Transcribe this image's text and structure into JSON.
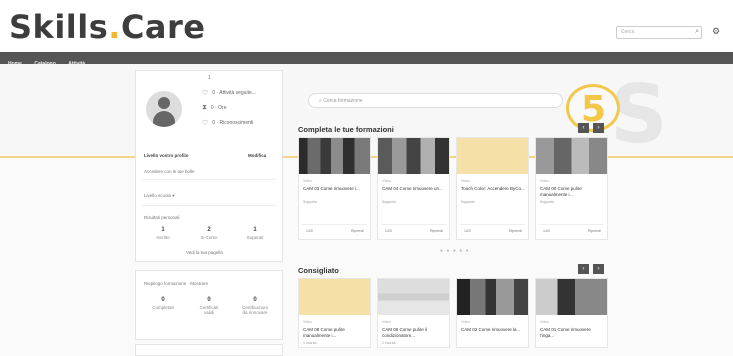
{
  "header": {
    "logo_part1": "Skills",
    "logo_dot": ".",
    "logo_part2": "Care",
    "search_placeholder": "Cerca",
    "search_btn": "⌕",
    "user_icon": "⚙"
  },
  "nav": {
    "items": [
      "Home",
      "Catalogo",
      "Attività"
    ]
  },
  "profile": {
    "name": "1",
    "links": [
      {
        "icon": "heart-icon",
        "glyph": "♡",
        "label": "0 · Attività seguite..."
      },
      {
        "icon": "hourglass-icon",
        "glyph": "⧗",
        "label": "0 · Ore"
      },
      {
        "icon": "trophy-icon",
        "glyph": "♡",
        "label": "0 · Riconoscimenti"
      }
    ],
    "level_label": "Livello vostro profilo",
    "level_value": "Modifica",
    "level_sub": "Accedere con le tue bolle",
    "select_label": "Livello scuola ▾",
    "progress_label": "Risultati personali",
    "counts": [
      {
        "value": "1",
        "label": "Iscritto"
      },
      {
        "value": "2",
        "label": "In Corso"
      },
      {
        "value": "1",
        "label": "Superati"
      }
    ],
    "progress_link": "Vedi la tua pagella"
  },
  "stats": {
    "title": "Riepilogo formazione · Mostrare",
    "counts": [
      {
        "value": "0",
        "label": "Completati"
      },
      {
        "value": "0",
        "label": "Certificati validi"
      },
      {
        "value": "0",
        "label": "Certificazioni da rinnovare"
      }
    ]
  },
  "main": {
    "search_placeholder": "Cerca formazione",
    "badge_number": "5",
    "section1_title": "Completa le tue formazioni",
    "section2_title": "Consigliato",
    "nav_prev": "‹",
    "nav_next": "›",
    "pagination": "● ● ● ● ●"
  },
  "courses_row1": [
    {
      "meta": "Video",
      "title": "CAM 03 Come rimuovere i...",
      "sub": "Supporto",
      "left": "14/0",
      "right": "Riprendi",
      "thumb": "photo-a"
    },
    {
      "meta": "Video",
      "title": "CAM 04 Come rimuovere un...",
      "sub": "Supporto",
      "left": "14/0",
      "right": "Riprendi",
      "thumb": "photo-b"
    },
    {
      "meta": "Video",
      "title": "Touch Color: Accendere ByCo...",
      "sub": "Supporto",
      "left": "14/0",
      "right": "Riprendi",
      "thumb": "photo-c"
    },
    {
      "meta": "Video",
      "title": "CAM 00 Come pulire manualmente i...",
      "sub": "Supporto",
      "left": "14/0",
      "right": "Riprendi",
      "thumb": "photo-d"
    }
  ],
  "courses_row2": [
    {
      "meta": "Video",
      "title": "CAM 08 Come pulire manualmente i...",
      "sub": "1 risorsa",
      "thumb": "photo-c"
    },
    {
      "meta": "Video",
      "title": "CAM 06 Come pulire il condizionatore...",
      "sub": "1 risorsa",
      "thumb": "photo-e"
    },
    {
      "meta": "Video",
      "title": "CAM 02 Come rimuovere la...",
      "sub": "",
      "thumb": "photo-f"
    },
    {
      "meta": "Video",
      "title": "CAM 01 Come rimuovere l'inga...",
      "sub": "",
      "thumb": "photo-g"
    }
  ],
  "colors": {
    "accent": "#f2b632",
    "nav": "#555555",
    "badge": "#f2c84b"
  }
}
